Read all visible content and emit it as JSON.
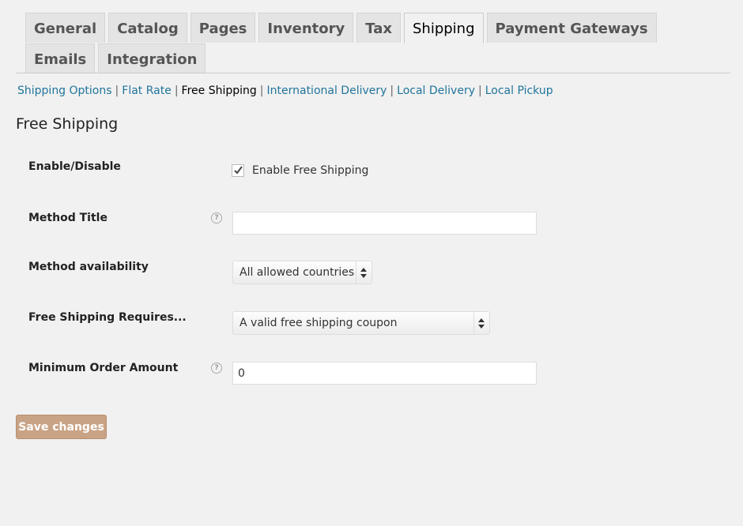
{
  "tabs": [
    {
      "label": "General"
    },
    {
      "label": "Catalog"
    },
    {
      "label": "Pages"
    },
    {
      "label": "Inventory"
    },
    {
      "label": "Tax"
    },
    {
      "label": "Shipping"
    },
    {
      "label": "Payment Gateways"
    },
    {
      "label": "Emails"
    },
    {
      "label": "Integration"
    }
  ],
  "active_tab": "Shipping",
  "subnav": {
    "items": [
      {
        "label": "Shipping Options"
      },
      {
        "label": "Flat Rate"
      },
      {
        "label": "Free Shipping"
      },
      {
        "label": "International Delivery"
      },
      {
        "label": "Local Delivery"
      },
      {
        "label": "Local Pickup"
      }
    ],
    "current": "Free Shipping",
    "separator": "|"
  },
  "section_title": "Free Shipping",
  "fields": {
    "enable": {
      "label": "Enable/Disable",
      "checkbox_label": "Enable Free Shipping",
      "checked": true
    },
    "method_title": {
      "label": "Method Title",
      "value": "",
      "help_icon": "?"
    },
    "availability": {
      "label": "Method availability",
      "selected": "All allowed countries"
    },
    "requires": {
      "label": "Free Shipping Requires...",
      "selected": "A valid free shipping coupon"
    },
    "min_amount": {
      "label": "Minimum Order Amount",
      "value": "0",
      "help_icon": "?"
    }
  },
  "save_button": {
    "label": "Save changes"
  },
  "colors": {
    "link": "#21759b",
    "save_button_bg": "#c9a385",
    "page_bg": "#f1f1f1"
  }
}
